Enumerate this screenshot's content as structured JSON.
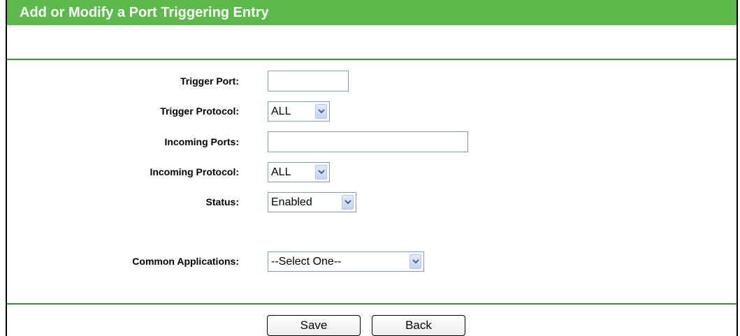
{
  "title": "Add or Modify a Port Triggering Entry",
  "fields": {
    "trigger_port_label": "Trigger Port:",
    "trigger_port_value": "",
    "trigger_protocol_label": "Trigger Protocol:",
    "trigger_protocol_value": "ALL",
    "incoming_ports_label": "Incoming Ports:",
    "incoming_ports_value": "",
    "incoming_protocol_label": "Incoming Protocol:",
    "incoming_protocol_value": "ALL",
    "status_label": "Status:",
    "status_value": "Enabled",
    "common_apps_label": "Common Applications:",
    "common_apps_value": "--Select One--"
  },
  "buttons": {
    "save": "Save",
    "back": "Back"
  },
  "colors": {
    "title_bar": "#5cb94b",
    "divider": "#3d8f3d"
  },
  "icons": {
    "dropdown": "chevron-down-icon"
  }
}
